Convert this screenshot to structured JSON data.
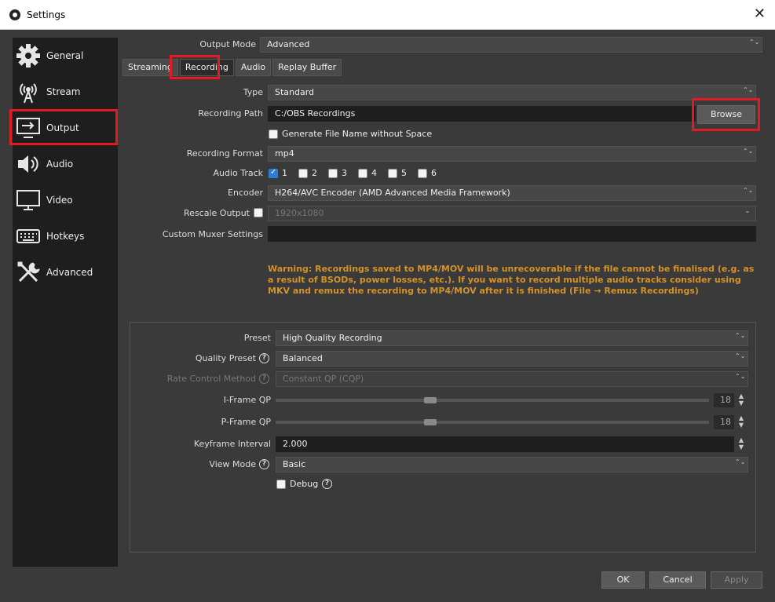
{
  "window": {
    "title": "Settings",
    "close_glyph": "✕"
  },
  "sidebar": {
    "items": [
      {
        "label": "General",
        "icon": "gear-icon"
      },
      {
        "label": "Stream",
        "icon": "antenna-icon"
      },
      {
        "label": "Output",
        "icon": "output-monitor-icon"
      },
      {
        "label": "Audio",
        "icon": "speaker-icon"
      },
      {
        "label": "Video",
        "icon": "monitor-icon"
      },
      {
        "label": "Hotkeys",
        "icon": "keyboard-icon"
      },
      {
        "label": "Advanced",
        "icon": "tools-icon"
      }
    ],
    "selected": "Output"
  },
  "output_mode": {
    "label": "Output Mode",
    "value": "Advanced"
  },
  "tabs": [
    "Streaming",
    "Recording",
    "Audio",
    "Replay Buffer"
  ],
  "active_tab": "Recording",
  "recording": {
    "type_label": "Type",
    "type_value": "Standard",
    "path_label": "Recording Path",
    "path_value": "C:/OBS Recordings",
    "browse_label": "Browse",
    "gen_filename_label": "Generate File Name without Space",
    "format_label": "Recording Format",
    "format_value": "mp4",
    "audio_track_label": "Audio Track",
    "tracks": [
      "1",
      "2",
      "3",
      "4",
      "5",
      "6"
    ],
    "encoder_label": "Encoder",
    "encoder_value": "H264/AVC Encoder (AMD Advanced Media Framework)",
    "rescale_label": "Rescale Output",
    "rescale_value": "1920x1080",
    "muxer_label": "Custom Muxer Settings",
    "muxer_value": "",
    "warning": "Warning: Recordings saved to MP4/MOV will be unrecoverable if the file cannot be finalised (e.g. as a result of BSODs, power losses, etc.). If you want to record multiple audio tracks consider using MKV and remux the recording to MP4/MOV after it is finished (File → Remux Recordings)"
  },
  "encoder_settings": {
    "preset_label": "Preset",
    "preset_value": "High Quality Recording",
    "quality_preset_label": "Quality Preset",
    "quality_preset_value": "Balanced",
    "rate_control_label": "Rate Control Method",
    "rate_control_value": "Constant QP (CQP)",
    "iframe_label": "I-Frame QP",
    "iframe_value": "18",
    "pframe_label": "P-Frame QP",
    "pframe_value": "18",
    "keyframe_label": "Keyframe Interval",
    "keyframe_value": "2.000",
    "view_mode_label": "View Mode",
    "view_mode_value": "Basic",
    "debug_label": "Debug",
    "help_glyph": "?"
  },
  "buttons": {
    "ok": "OK",
    "cancel": "Cancel",
    "apply": "Apply"
  },
  "glyphs": {
    "spin": "⌃⌄",
    "dropdown": "⌄",
    "up": "▲",
    "down": "▼"
  },
  "colors": {
    "highlight": "#e01b24",
    "warning": "#d4922a",
    "check": "#2a7fd4"
  }
}
